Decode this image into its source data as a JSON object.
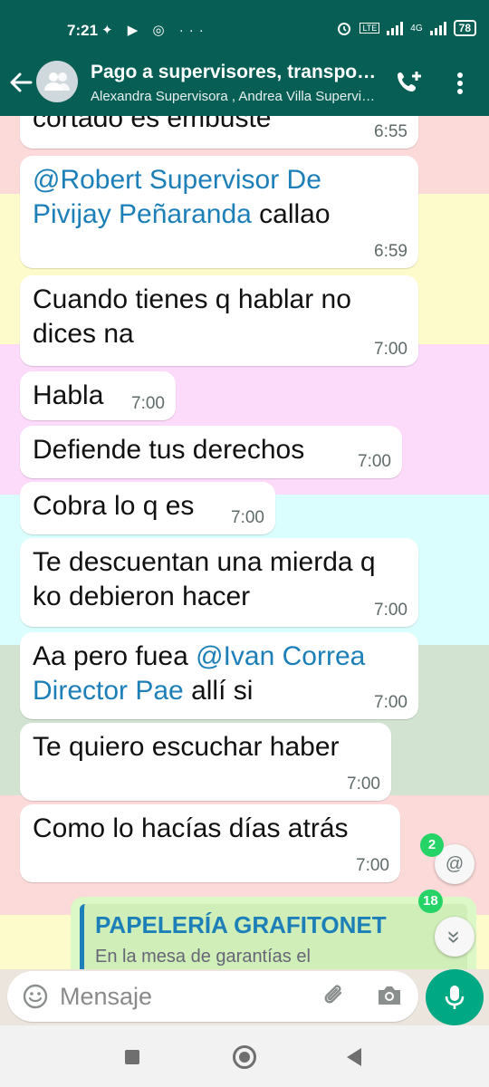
{
  "status_bar": {
    "time": "7:21",
    "left_icons": "✦ ▶ ◎",
    "more": "···",
    "lte": "LTE",
    "network": "4G",
    "battery": "78"
  },
  "header": {
    "title": "Pago a supervisores, transportadores",
    "subtitle": "Alexandra Supervisora , Andrea Villa Supervisora"
  },
  "messages": [
    {
      "text_parts": [
        {
          "t": "cortado es embuste",
          "mention": false
        }
      ],
      "time": "6:55"
    },
    {
      "text_parts": [
        {
          "t": "@Robert Supervisor De Pivijay Peñaranda",
          "mention": true
        },
        {
          "t": " callao",
          "mention": false
        }
      ],
      "time": "6:59"
    },
    {
      "text_parts": [
        {
          "t": "Cuando tienes q hablar no dices na",
          "mention": false
        }
      ],
      "time": "7:00"
    },
    {
      "text_parts": [
        {
          "t": "Habla",
          "mention": false
        }
      ],
      "time": "7:00"
    },
    {
      "text_parts": [
        {
          "t": "Defiende tus derechos",
          "mention": false
        }
      ],
      "time": "7:00"
    },
    {
      "text_parts": [
        {
          "t": "Cobra lo q es",
          "mention": false
        }
      ],
      "time": "7:00"
    },
    {
      "text_parts": [
        {
          "t": "Te descuentan una mierda q ko debieron hacer",
          "mention": false
        }
      ],
      "time": "7:00"
    },
    {
      "text_parts": [
        {
          "t": "Aa pero fuea ",
          "mention": false
        },
        {
          "t": "@Ivan Correa Director Pae",
          "mention": true
        },
        {
          "t": " allí si",
          "mention": false
        }
      ],
      "time": "7:00"
    },
    {
      "text_parts": [
        {
          "t": "Te quiero escuchar haber",
          "mention": false
        }
      ],
      "time": "7:00"
    },
    {
      "text_parts": [
        {
          "t": "Como lo hacías días atrás",
          "mention": false
        }
      ],
      "time": "7:00"
    }
  ],
  "quoted": {
    "title": "PAPELERÍA GRAFITONET",
    "text": "En la mesa de garantías el"
  },
  "floating": {
    "mentions_badge": "2",
    "mentions_icon": "@",
    "unread_badge": "18",
    "scroll_icon": "»"
  },
  "composer": {
    "placeholder": "Mensaje"
  },
  "colors": {
    "header": "#075e54",
    "accent": "#00a884",
    "mention": "#1c7fb8",
    "badge": "#25d366",
    "bands": [
      "#fcdada",
      "#fdfbcb",
      "#fcdafa",
      "#dafefd",
      "#d2e3d2",
      "#fcdada",
      "#fdfbcb"
    ]
  }
}
